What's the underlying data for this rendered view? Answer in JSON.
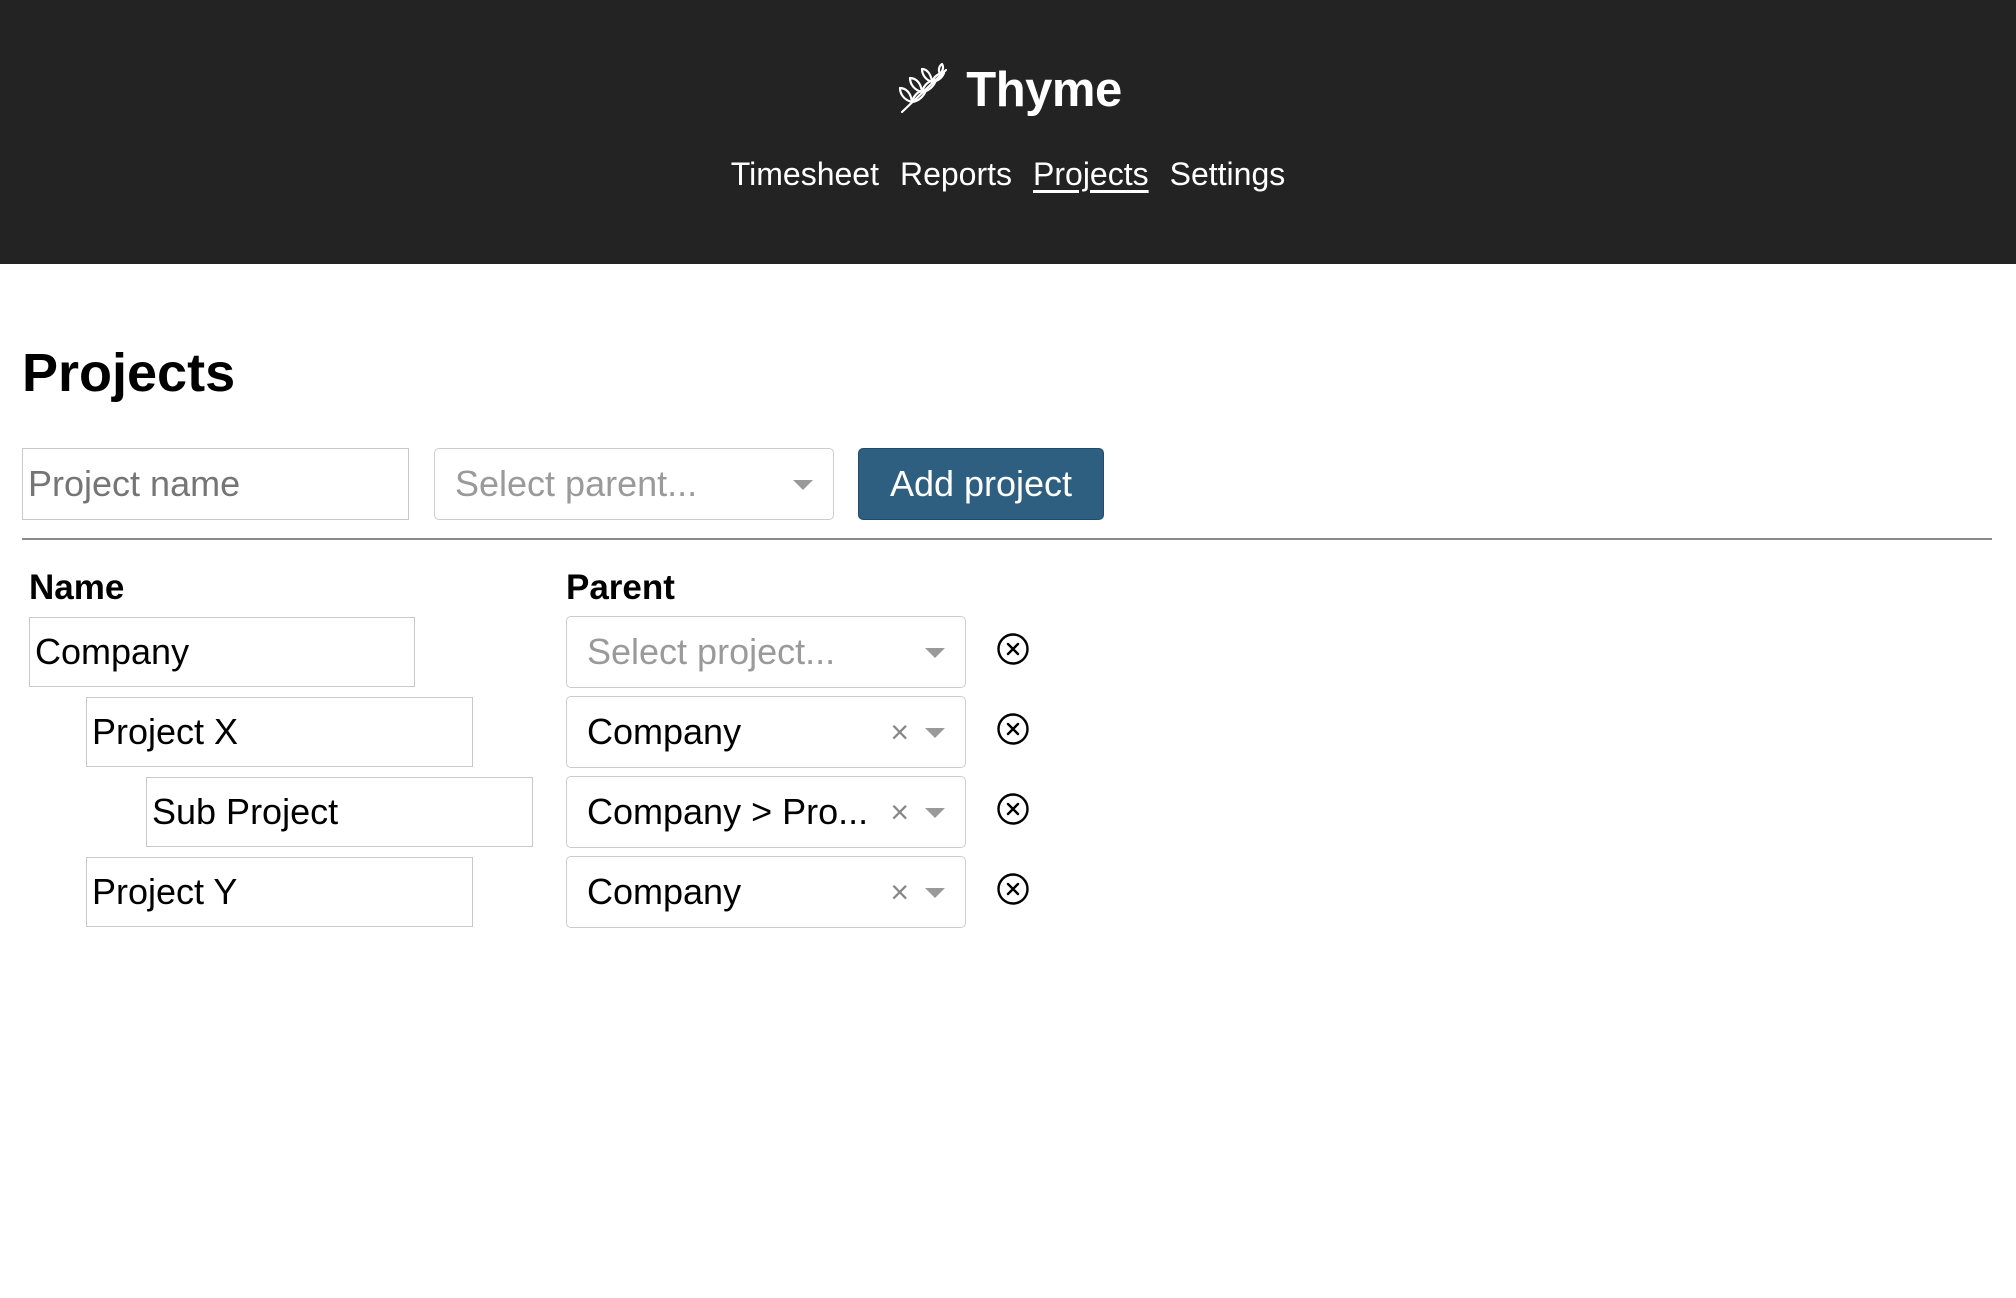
{
  "app": {
    "name": "Thyme",
    "logo_icon": "thyme-leaf-icon"
  },
  "nav": {
    "items": [
      {
        "label": "Timesheet",
        "active": false
      },
      {
        "label": "Reports",
        "active": false
      },
      {
        "label": "Projects",
        "active": true
      },
      {
        "label": "Settings",
        "active": false
      }
    ]
  },
  "page": {
    "title": "Projects"
  },
  "new_project": {
    "name_placeholder": "Project name",
    "name_value": "",
    "parent_placeholder": "Select parent...",
    "add_button_label": "Add project"
  },
  "table": {
    "headers": {
      "name": "Name",
      "parent": "Parent"
    },
    "select_placeholder": "Select project...",
    "rows": [
      {
        "name": "Company",
        "depth": 0,
        "parent": "",
        "delete_icon": "circle-x-icon"
      },
      {
        "name": "Project X",
        "depth": 1,
        "parent": "Company",
        "delete_icon": "circle-x-icon"
      },
      {
        "name": "Sub Project",
        "depth": 2,
        "parent": "Company > Pro...",
        "delete_icon": "circle-x-icon"
      },
      {
        "name": "Project Y",
        "depth": 1,
        "parent": "Company",
        "delete_icon": "circle-x-icon"
      }
    ]
  },
  "colors": {
    "header_bg": "#232323",
    "accent_button": "#2e5f80"
  }
}
